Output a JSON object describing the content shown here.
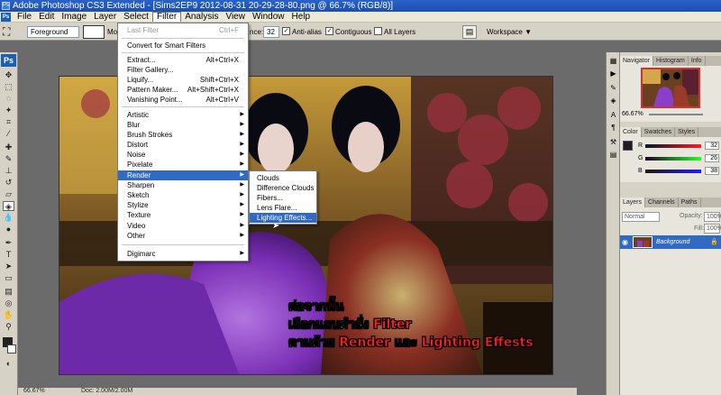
{
  "window": {
    "title": "Adobe Photoshop CS3 Extended - [Sims2EP9 2012-08-31 20-29-28-80.png @ 66.7% (RGB/8)]",
    "app_icon": "photoshop-icon"
  },
  "menubar": {
    "items": [
      "File",
      "Edit",
      "Image",
      "Layer",
      "Select",
      "Filter",
      "Analysis",
      "View",
      "Window",
      "Help"
    ],
    "active": "Filter"
  },
  "options": {
    "fill_source": "Foreground",
    "mode_label": "Mo",
    "tolerance_label": "nce:",
    "tolerance_value": "32",
    "antialias_label": "Anti-alias",
    "contiguous_label": "Contiguous",
    "all_layers_label": "All Layers",
    "workspace_label": "Workspace ▼"
  },
  "filter_menu": {
    "last_filter": "Last Filter",
    "last_filter_shortcut": "Ctrl+F",
    "convert": "Convert for Smart Filters",
    "group1": [
      {
        "label": "Extract...",
        "shortcut": "Alt+Ctrl+X"
      },
      {
        "label": "Filter Gallery...",
        "shortcut": ""
      },
      {
        "label": "Liquify...",
        "shortcut": "Shift+Ctrl+X"
      },
      {
        "label": "Pattern Maker...",
        "shortcut": "Alt+Shift+Ctrl+X"
      },
      {
        "label": "Vanishing Point...",
        "shortcut": "Alt+Ctrl+V"
      }
    ],
    "group2": [
      "Artistic",
      "Blur",
      "Brush Strokes",
      "Distort",
      "Noise",
      "Pixelate",
      "Render",
      "Sharpen",
      "Sketch",
      "Stylize",
      "Texture",
      "Video",
      "Other"
    ],
    "selected": "Render",
    "digimarc": "Digimarc"
  },
  "render_submenu": {
    "items": [
      "Clouds",
      "Difference Clouds",
      "Fibers...",
      "Lens Flare...",
      "Lighting Effects..."
    ],
    "selected": "Lighting Effects..."
  },
  "annotation": {
    "line1": "ต่อจากนั้น",
    "line2_a": "เลือกแถบคำสั่ง ",
    "line2_b": "Filter",
    "line3_a": "ตามด้วย ",
    "line3_b": "Render",
    "line3_c": " และ ",
    "line3_d": "Lighting Effests"
  },
  "panels": {
    "nav_tabs": [
      "Navigator",
      "Histogram",
      "Info"
    ],
    "zoom": "66.67%",
    "color_tabs": [
      "Color",
      "Swatches",
      "Styles"
    ],
    "color_rows": [
      {
        "ch": "R",
        "val": "32"
      },
      {
        "ch": "G",
        "val": "26"
      },
      {
        "ch": "B",
        "val": "38"
      }
    ],
    "layer_tabs": [
      "Layers",
      "Channels",
      "Paths"
    ],
    "blend_mode": "Normal",
    "opacity_label": "Opacity:",
    "opacity_value": "100%",
    "fill_label": "Fill:",
    "fill_value": "100%",
    "layer_name": "Background"
  },
  "status": {
    "zoom": "66.67%",
    "doc": "Doc: 2.00M/2.00M"
  },
  "colors": {
    "accent": "#316ac5",
    "annotation_red": "#ff1e1e"
  }
}
